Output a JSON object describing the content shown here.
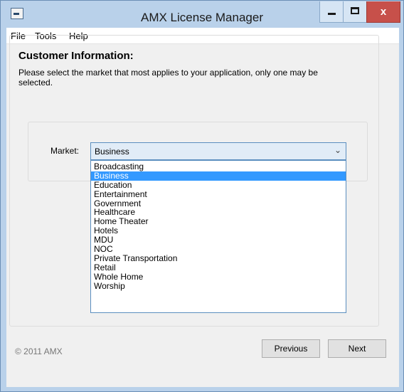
{
  "window": {
    "title": "AMX License Manager",
    "close_glyph": "x"
  },
  "menu": [
    "File",
    "Tools",
    "Help"
  ],
  "customer": {
    "heading": "Customer Information:",
    "description": "Please select the market that most applies to your application, only one may be selected."
  },
  "market": {
    "label": "Market:",
    "selected": "Business",
    "arrow": "⌄",
    "options": [
      "Broadcasting",
      "Business",
      "Education",
      "Entertainment",
      "Government",
      "Healthcare",
      "Home Theater",
      "Hotels",
      "MDU",
      "NOC",
      "Private Transportation",
      "Retail",
      "Whole Home",
      "Worship"
    ],
    "selected_index": 1
  },
  "footer": {
    "copyright": "© 2011 AMX",
    "previous_label": "Previous",
    "next_label": "Next"
  },
  "colors": {
    "title_bar": "#b9d1ea",
    "close_button": "#c7504a",
    "selection": "#3399ff"
  },
  "icons": {
    "app": "app-icon",
    "minimize": "minimize-icon",
    "maximize": "maximize-icon",
    "close": "close-icon",
    "dropdown": "chevron-down-icon"
  }
}
